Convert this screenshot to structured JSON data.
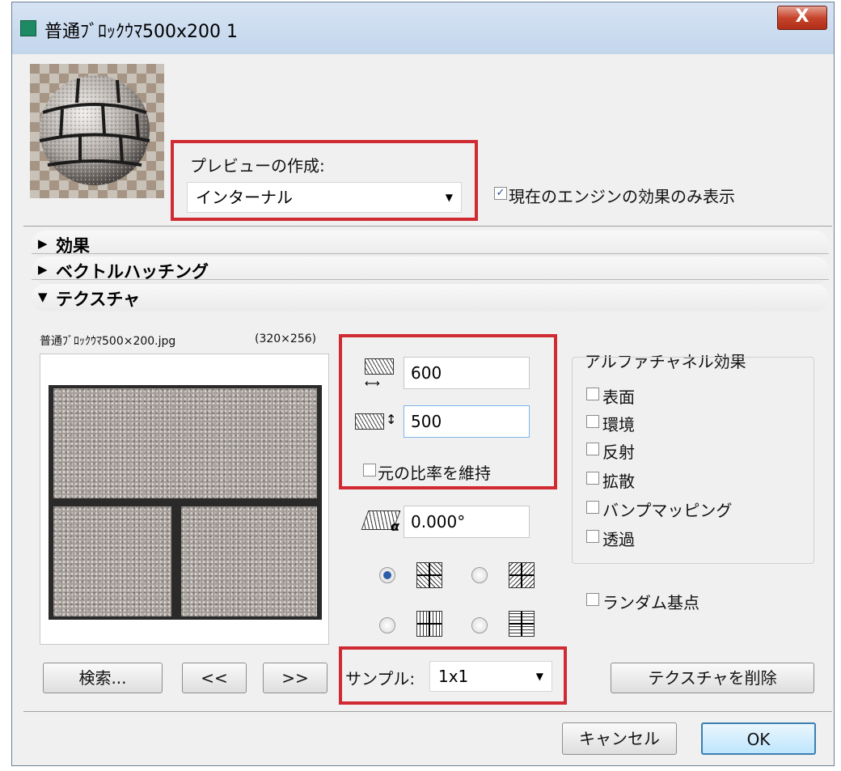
{
  "window": {
    "title": "普通ﾌﾞﾛｯｸｳﾏ500x200 1",
    "close_glyph": "X"
  },
  "preview": {
    "create_label": "プレビューの作成:",
    "engine_select": "インターナル",
    "current_engine_only_label": "現在のエンジンの効果のみ表示",
    "current_engine_only_checked": true
  },
  "sections": [
    {
      "label": "効果",
      "arrow": "▶",
      "expanded": false
    },
    {
      "label": "ベクトルハッチング",
      "arrow": "▶",
      "expanded": false
    },
    {
      "label": "テクスチャ",
      "arrow": "▼",
      "expanded": true
    }
  ],
  "texture": {
    "file_name": "普通ﾌﾞﾛｯｸｳﾏ500×200.jpg",
    "file_size": "(320×256)",
    "width_value": "600",
    "height_value": "500",
    "keep_ratio_label": "元の比率を維持",
    "keep_ratio_checked": false,
    "rotation_value": "0.000°",
    "sample_label": "サンプル:",
    "sample_value": "1x1",
    "search_button": "検索...",
    "prev_button": "<<",
    "next_button": ">>",
    "delete_button": "テクスチャを削除",
    "mirror_selected_index": 0
  },
  "alpha": {
    "title": "アルファチャネル効果",
    "options": [
      {
        "label": "表面",
        "checked": false
      },
      {
        "label": "環境",
        "checked": false
      },
      {
        "label": "反射",
        "checked": false
      },
      {
        "label": "拡散",
        "checked": false
      },
      {
        "label": "バンプマッピング",
        "checked": false
      },
      {
        "label": "透過",
        "checked": false
      }
    ],
    "random_origin_label": "ランダム基点",
    "random_origin_checked": false
  },
  "footer": {
    "cancel_button": "キャンセル",
    "ok_button": "OK"
  },
  "colors": {
    "highlight": "#d02a32",
    "window_bg": "#f0f0f0"
  }
}
